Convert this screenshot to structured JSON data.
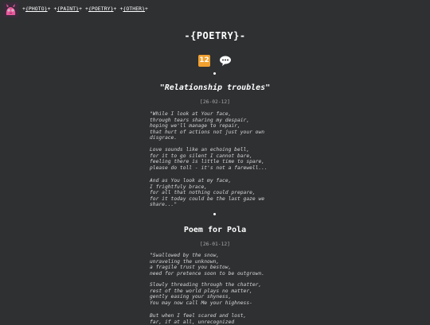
{
  "nav": {
    "prefix": "+",
    "items": [
      {
        "label": "{PHOTO}"
      },
      {
        "label": "{PAINT}"
      },
      {
        "label": "{POETRY}"
      },
      {
        "label": "{OTHER}"
      }
    ],
    "separator": "+"
  },
  "page_title": "-{POETRY}-",
  "icons": {
    "badge_number": "12",
    "badge_icon": "number-12-icon",
    "chat_icon": "speech-bubble-icon"
  },
  "colors": {
    "background": "#2e3032",
    "text": "#e6e6e6",
    "badge": "#f0a030"
  },
  "posts": [
    {
      "title": "\"Relationship troubles\"",
      "date": "[26-02-12]",
      "stanzas": [
        "\"While I look at Your face,\nthrough tears sharing my despair,\nhoping we'll manage to repair,\nthat hurt of actions not just your own\ndisgrace.",
        "Love sounds like an echoing bell,\nfor it to go silent I cannot bare,\nfeeling there is little time to spare,\nplease do toll - it's not a farewell...",
        "And as You look at my face,\nI frightfuly brace,\nfor all that nothing could prepare,\nfor it today could be the last gaze we\nshare...\""
      ]
    },
    {
      "title": "Poem for Pola",
      "date": "[26-01-12]",
      "stanzas": [
        "\"Swallowed by the snow,\nunraveling the unknown,\na fragile trust you bestow,\nneed for pretence soon to be outgrown.",
        "Slowly threading through the chatter,\nrest of the world plays no matter,\ngently easing your shyness,\nYou may now call Me your highness-",
        "But when I feel scared and lost,\nfar, if at all, unrecognized"
      ]
    }
  ]
}
